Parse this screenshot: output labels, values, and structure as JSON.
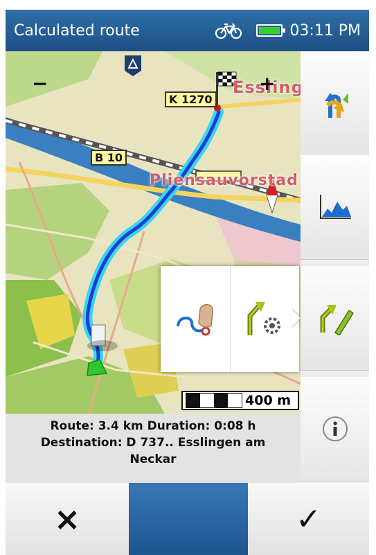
{
  "header": {
    "title": "Calculated route",
    "time": "03:11 PM",
    "battery_level": 1.0,
    "icons": [
      "bicycle-icon",
      "battery-icon"
    ],
    "bg_color": "#1c4f84"
  },
  "map": {
    "road_labels": [
      "K 1270",
      "B 10"
    ],
    "town_labels": [
      "Essling",
      "Pliensauvorstad"
    ],
    "zoom_out_label": "−",
    "zoom_in_label": "+",
    "scale_label": "400 m",
    "route_color": "#1a3fd4",
    "route_glow_color": "#39d4f0"
  },
  "popup": {
    "items": [
      {
        "name": "draw-route-icon"
      },
      {
        "name": "route-settings-icon"
      }
    ]
  },
  "side_buttons": [
    {
      "name": "route-options-icon"
    },
    {
      "name": "elevation-profile-icon"
    },
    {
      "name": "edit-route-icon"
    },
    {
      "name": "info-icon"
    }
  ],
  "info": {
    "line1": "Route: 3.4 km Duration: 0:08 h",
    "line2": "Destination: D 737.. Esslingen am",
    "line3": "Neckar"
  },
  "bottom_bar": {
    "cancel_icon": "×",
    "confirm_icon": "✓"
  }
}
